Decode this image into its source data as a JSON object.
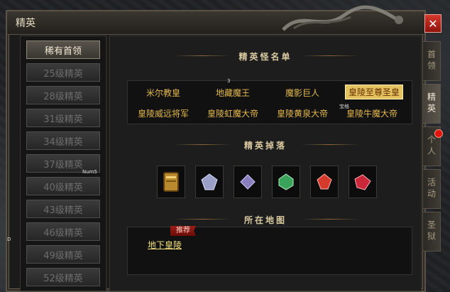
{
  "window": {
    "title": "精英"
  },
  "close_glyph": "✕",
  "left_list": {
    "items": [
      {
        "label": "稀有首领",
        "active": true
      },
      {
        "label": "25级精英"
      },
      {
        "label": "28级精英"
      },
      {
        "label": "31级精英"
      },
      {
        "label": "34级精英"
      },
      {
        "label": "37级精英"
      },
      {
        "label": "40级精英"
      },
      {
        "label": "43级精英"
      },
      {
        "label": "46级精英"
      },
      {
        "label": "49级精英"
      },
      {
        "label": "52级精英"
      }
    ]
  },
  "content": {
    "names_title": "精英怪名单",
    "drops_title": "精英掉落",
    "map_title": "所在地图",
    "bosses": [
      {
        "name": "米尔教皇"
      },
      {
        "name": "地藏魔王"
      },
      {
        "name": "魔影巨人"
      },
      {
        "name": "皇陵至尊圣皇",
        "selected": true
      },
      {
        "name": "皇陵威远将军"
      },
      {
        "name": "皇陵虹魔大帝"
      },
      {
        "name": "皇陵黄泉大帝"
      },
      {
        "name": "皇陵牛魔大帝"
      }
    ],
    "drops": [
      {
        "icon": "book-icon",
        "color": "#b8892d"
      },
      {
        "icon": "crystal-icon",
        "color": "#9aa0c8"
      },
      {
        "icon": "crystal-icon",
        "color": "#8a7fbd"
      },
      {
        "icon": "gem-icon",
        "color": "#3aa35a"
      },
      {
        "icon": "gem-icon",
        "color": "#d63a2d"
      },
      {
        "icon": "gem-icon",
        "color": "#c9283a"
      }
    ],
    "map": {
      "recommend_badge": "推荐",
      "location": "地下皇陵"
    }
  },
  "right_tabs": [
    {
      "label": "首领"
    },
    {
      "label": "精英",
      "active": true
    },
    {
      "label": "个人",
      "has_alert": true
    },
    {
      "label": "活动"
    },
    {
      "label": "圣狱"
    }
  ],
  "overlay_labels": {
    "num5": "Num5",
    "three": "3",
    "zhongge": "宝格",
    "d_char": "D"
  },
  "colors": {
    "accent_gold": "#e3b84d",
    "selected_bg": "#e3c260",
    "close_red": "#d6382b",
    "alert_red": "#e2140a"
  }
}
